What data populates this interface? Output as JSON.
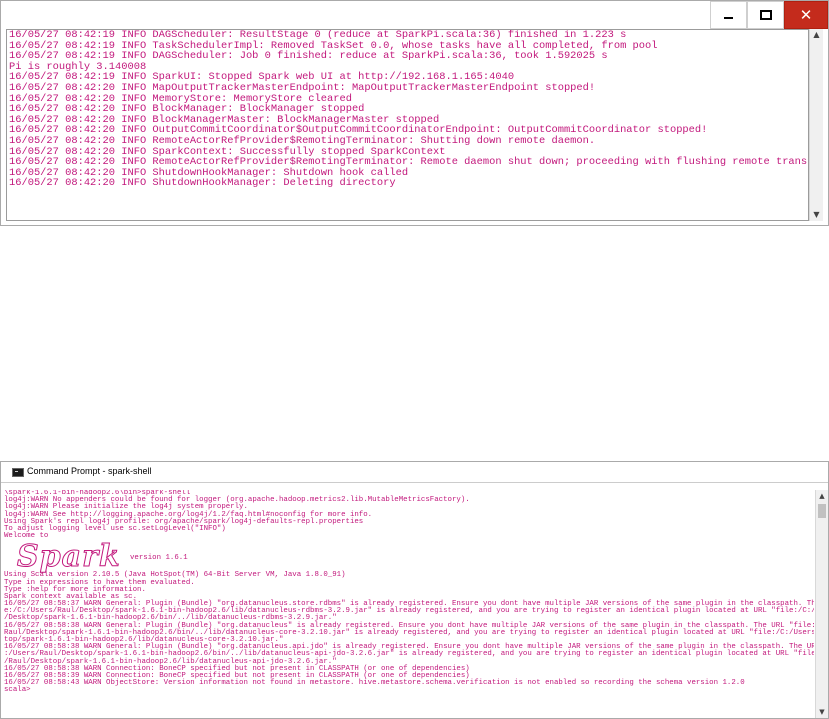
{
  "window1": {
    "controls": {
      "minimize": "minimize",
      "maximize": "maximize",
      "close": "✕"
    },
    "lines": [
      "16/05/27 08:42:19 INFO DAGScheduler: ResultStage 0 (reduce at SparkPi.scala:36) finished in 1.223 s",
      "16/05/27 08:42:19 INFO TaskSchedulerImpl: Removed TaskSet 0.0, whose tasks have all completed, from pool",
      "16/05/27 08:42:19 INFO DAGScheduler: Job 0 finished: reduce at SparkPi.scala:36, took 1.592025 s",
      "Pi is roughly 3.140008",
      "16/05/27 08:42:19 INFO SparkUI: Stopped Spark web UI at http://192.168.1.165:4040",
      "16/05/27 08:42:20 INFO MapOutputTrackerMasterEndpoint: MapOutputTrackerMasterEndpoint stopped!",
      "16/05/27 08:42:20 INFO MemoryStore: MemoryStore cleared",
      "16/05/27 08:42:20 INFO BlockManager: BlockManager stopped",
      "16/05/27 08:42:20 INFO BlockManagerMaster: BlockManagerMaster stopped",
      "16/05/27 08:42:20 INFO OutputCommitCoordinator$OutputCommitCoordinatorEndpoint: OutputCommitCoordinator stopped!",
      "16/05/27 08:42:20 INFO RemoteActorRefProvider$RemotingTerminator: Shutting down remote daemon.",
      "16/05/27 08:42:20 INFO SparkContext: Successfully stopped SparkContext",
      "16/05/27 08:42:20 INFO RemoteActorRefProvider$RemotingTerminator: Remote daemon shut down; proceeding with flushing remote transports.",
      "16/05/27 08:42:20 INFO ShutdownHookManager: Shutdown hook called",
      "16/05/27 08:42:20 INFO ShutdownHookManager: Deleting directory"
    ]
  },
  "window2": {
    "title": "Command Prompt - spark-shell",
    "lines_before_logo": [
      "\\spark-1.6.1-bin-hadoop2.6\\bin>spark-shell",
      "log4j:WARN No appenders could be found for logger (org.apache.hadoop.metrics2.lib.MutableMetricsFactory).",
      "log4j:WARN Please initialize the log4j system properly.",
      "log4j:WARN See http://logging.apache.org/log4j/1.2/faq.html#noconfig for more info.",
      "Using Spark's repl log4j profile: org/apache/spark/log4j-defaults-repl.properties",
      "To adjust logging level use sc.setLogLevel(\"INFO\")",
      "Welcome to"
    ],
    "logo_text": "Spark",
    "version_text": "version 1.6.1",
    "lines_after_logo": [
      "Using Scala version 2.10.5 (Java HotSpot(TM) 64-Bit Server VM, Java 1.8.0_91)",
      "Type in expressions to have them evaluated.",
      "Type :help for more information.",
      "Spark context available as sc.",
      "16/05/27 08:58:37 WARN General: Plugin (Bundle) \"org.datanucleus.store.rdbms\" is already registered. Ensure you dont have multiple JAR versions of the same plugin in the classpath. The URL \"fil",
      "e:/C:/Users/Raul/Desktop/spark-1.6.1-bin-hadoop2.6/lib/datanucleus-rdbms-3.2.9.jar\" is already registered, and you are trying to register an identical plugin located at URL \"file:/C:/Users/Raul",
      "/Desktop/spark-1.6.1-bin-hadoop2.6/bin/../lib/datanucleus-rdbms-3.2.9.jar.\"",
      "16/05/27 08:58:38 WARN General: Plugin (Bundle) \"org.datanucleus\" is already registered. Ensure you dont have multiple JAR versions of the same plugin in the classpath. The URL \"file:/C:/Users/",
      "Raul/Desktop/spark-1.6.1-bin-hadoop2.6/bin/../lib/datanucleus-core-3.2.10.jar\" is already registered, and you are trying to register an identical plugin located at URL \"file:/C:/Users/Raul/Desk",
      "top/spark-1.6.1-bin-hadoop2.6/lib/datanucleus-core-3.2.10.jar.\"",
      "16/05/27 08:58:38 WARN General: Plugin (Bundle) \"org.datanucleus.api.jdo\" is already registered. Ensure you dont have multiple JAR versions of the same plugin in the classpath. The URL \"file:/C",
      ":/Users/Raul/Desktop/spark-1.6.1-bin-hadoop2.6/bin/../lib/datanucleus-api-jdo-3.2.6.jar\" is already registered, and you are trying to register an identical plugin located at URL \"file:/C:/Users",
      "/Raul/Desktop/spark-1.6.1-bin-hadoop2.6/lib/datanucleus-api-jdo-3.2.6.jar.\"",
      "16/05/27 08:58:38 WARN Connection: BoneCP specified but not present in CLASSPATH (or one of dependencies)",
      "16/05/27 08:58:39 WARN Connection: BoneCP specified but not present in CLASSPATH (or one of dependencies)",
      "16/05/27 08:58:43 WARN ObjectStore: Version information not found in metastore. hive.metastore.schema.verification is not enabled so recording the schema version 1.2.0",
      "scala>"
    ]
  }
}
